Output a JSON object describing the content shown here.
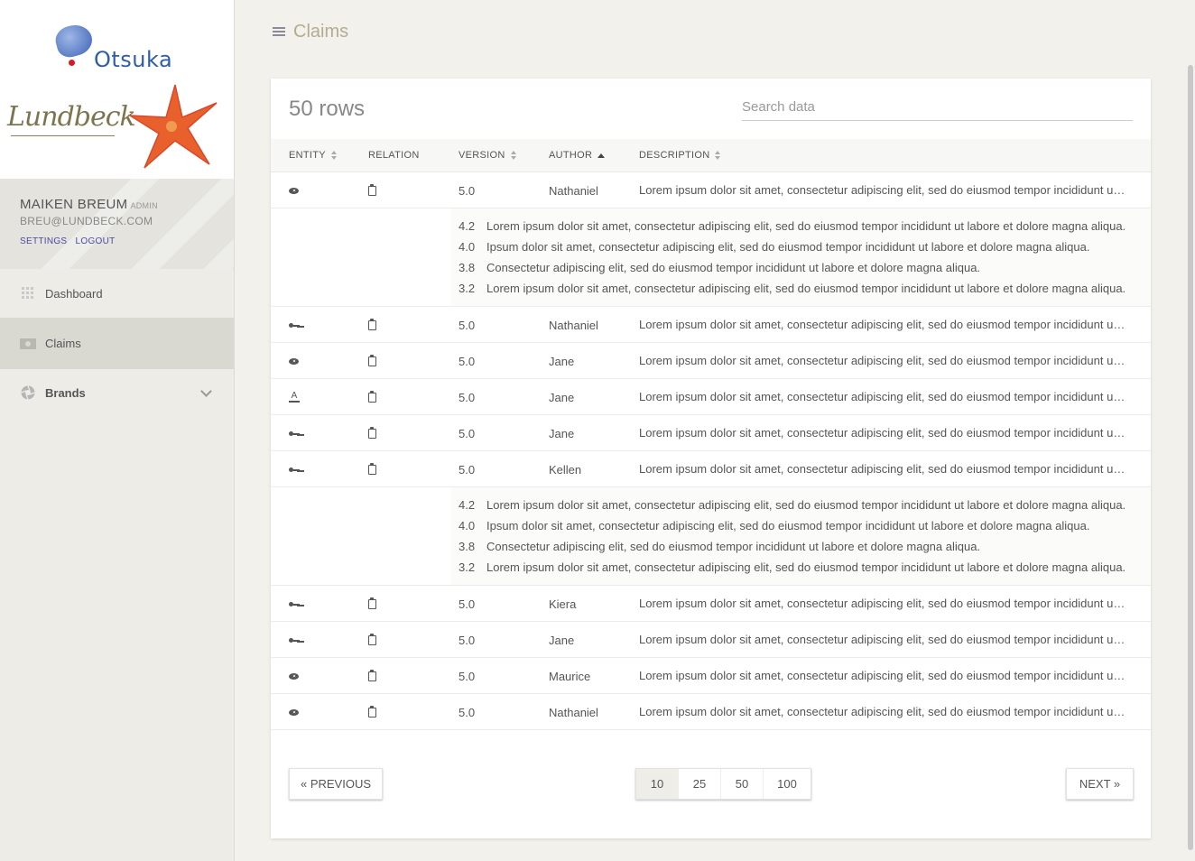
{
  "sidebar": {
    "logo_otsuka": "Otsuka",
    "logo_lundbeck": "Lundbeck",
    "user": {
      "name": "MAIKEN BREUM",
      "role": "ADMIN",
      "email": "BREU@LUNDBECK.COM",
      "settings": "SETTINGS",
      "logout": "LOGOUT"
    },
    "nav": [
      {
        "label": "Dashboard",
        "icon": "grid-icon"
      },
      {
        "label": "Claims",
        "icon": "claims-icon",
        "active": true
      },
      {
        "label": "Brands",
        "icon": "aperture-icon",
        "expandable": true
      }
    ]
  },
  "header": {
    "title": "Claims"
  },
  "table": {
    "rows_label": "50 rows",
    "search_placeholder": "Search data",
    "columns": [
      "ENTITY",
      "RELATION",
      "VERSION",
      "AUTHOR",
      "DESCRIPTION"
    ],
    "rows": [
      {
        "entity_icon": "eye-icon",
        "relation_icon": "clipboard-icon",
        "version": "5.0",
        "author": "Nathaniel",
        "description": "Lorem ipsum dolor sit amet, consectetur adipiscing elit, sed do eiusmod tempor incididunt ut labore et dolore magna aliqua.",
        "expanded": true
      },
      {
        "entity_icon": "key-icon",
        "relation_icon": "clipboard-icon",
        "version": "5.0",
        "author": "Nathaniel",
        "description": "Lorem ipsum dolor sit amet, consectetur adipiscing elit, sed do eiusmod tempor incididunt ut labore et dolore magna aliqua."
      },
      {
        "entity_icon": "eye-icon",
        "relation_icon": "clipboard-icon",
        "version": "5.0",
        "author": "Jane",
        "description": "Lorem ipsum dolor sit amet, consectetur adipiscing elit, sed do eiusmod tempor incididunt ut labore et dolore magna aliqua."
      },
      {
        "entity_icon": "font-color-icon",
        "relation_icon": "clipboard-icon",
        "version": "5.0",
        "author": "Jane",
        "description": "Lorem ipsum dolor sit amet, consectetur adipiscing elit, sed do eiusmod tempor incididunt ut labore et dolore magna aliqua."
      },
      {
        "entity_icon": "key-icon",
        "relation_icon": "clipboard-icon",
        "version": "5.0",
        "author": "Jane",
        "description": "Lorem ipsum dolor sit amet, consectetur adipiscing elit, sed do eiusmod tempor incididunt ut labore et dolore magna aliqua."
      },
      {
        "entity_icon": "key-icon",
        "relation_icon": "clipboard-icon",
        "version": "5.0",
        "author": "Kellen",
        "description": "Lorem ipsum dolor sit amet, consectetur adipiscing elit, sed do eiusmod tempor incididunt ut labore et dolore magna aliqua.",
        "expanded": true
      },
      {
        "entity_icon": "key-icon",
        "relation_icon": "clipboard-icon",
        "version": "5.0",
        "author": "Kiera",
        "description": "Lorem ipsum dolor sit amet, consectetur adipiscing elit, sed do eiusmod tempor incididunt ut labore et dolore magna aliqua."
      },
      {
        "entity_icon": "key-icon",
        "relation_icon": "clipboard-icon",
        "version": "5.0",
        "author": "Jane",
        "description": "Lorem ipsum dolor sit amet, consectetur adipiscing elit, sed do eiusmod tempor incididunt ut labore et dolore magna aliqua."
      },
      {
        "entity_icon": "eye-icon",
        "relation_icon": "clipboard-icon",
        "version": "5.0",
        "author": "Maurice",
        "description": "Lorem ipsum dolor sit amet, consectetur adipiscing elit, sed do eiusmod tempor incididunt ut labore et dolore magna aliqua."
      },
      {
        "entity_icon": "eye-icon",
        "relation_icon": "clipboard-icon",
        "version": "5.0",
        "author": "Nathaniel",
        "description": "Lorem ipsum dolor sit amet, consectetur adipiscing elit, sed do eiusmod tempor incididunt ut labore et dolore magna aliqua."
      }
    ],
    "history": [
      {
        "version": "4.2",
        "text": "Lorem ipsum dolor sit amet, consectetur adipiscing elit, sed do eiusmod tempor incididunt ut labore et dolore magna aliqua."
      },
      {
        "version": "4.0",
        "text": "Ipsum dolor sit amet, consectetur adipiscing elit, sed do eiusmod tempor incididunt ut labore et dolore magna aliqua."
      },
      {
        "version": "3.8",
        "text": "Consectetur adipiscing elit, sed do eiusmod tempor incididunt ut labore et dolore magna aliqua."
      },
      {
        "version": "3.2",
        "text": "Lorem ipsum dolor sit amet, consectetur adipiscing elit, sed do eiusmod tempor incididunt ut labore et dolore magna aliqua."
      }
    ]
  },
  "pagination": {
    "previous": "« PREVIOUS",
    "next": "NEXT »",
    "page_sizes": [
      "10",
      "25",
      "50",
      "100"
    ],
    "active_page_size": "10"
  }
}
